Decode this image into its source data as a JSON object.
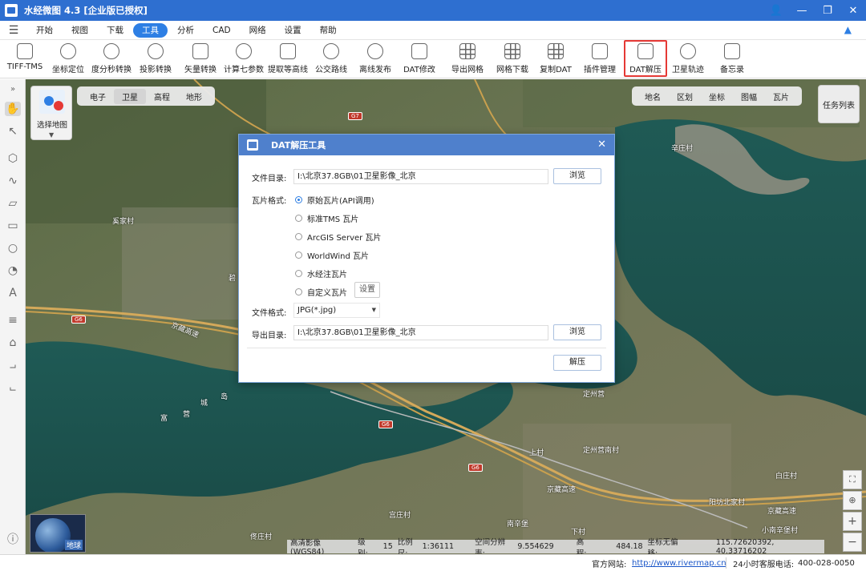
{
  "app": {
    "title": "水经微图 4.3 [企业版已授权]"
  },
  "menu": {
    "items": [
      "开始",
      "视图",
      "下载",
      "工具",
      "分析",
      "CAD",
      "网络",
      "设置",
      "帮助"
    ],
    "active": "工具"
  },
  "toolbar": {
    "items": [
      {
        "label": "TIFF-TMS",
        "icon": "tiff-tms-icon"
      },
      {
        "label": "坐标定位",
        "icon": "crosshair-icon"
      },
      {
        "label": "度分秒转换",
        "icon": "dms-convert-icon"
      },
      {
        "label": "投影转换",
        "icon": "projection-icon"
      },
      {
        "label": "矢量转换",
        "icon": "vector-convert-icon"
      },
      {
        "label": "计算七参数",
        "icon": "seven-param-icon"
      },
      {
        "label": "提取等高线",
        "icon": "contour-icon"
      },
      {
        "label": "公交路线",
        "icon": "bus-route-icon"
      },
      {
        "label": "离线发布",
        "icon": "offline-publish-icon"
      },
      {
        "label": "DAT修改",
        "icon": "dat-edit-icon"
      },
      {
        "label": "导出网格",
        "icon": "export-grid-icon"
      },
      {
        "label": "网格下载",
        "icon": "grid-download-icon"
      },
      {
        "label": "复制DAT",
        "icon": "copy-dat-icon"
      },
      {
        "label": "插件管理",
        "icon": "plugin-icon"
      },
      {
        "label": "DAT解压",
        "icon": "dat-extract-icon"
      },
      {
        "label": "卫星轨迹",
        "icon": "satellite-track-icon"
      },
      {
        "label": "备忘录",
        "icon": "memo-icon"
      }
    ],
    "highlighted": "DAT解压"
  },
  "maptypes": {
    "items": [
      "电子",
      "卫星",
      "高程",
      "地形"
    ],
    "selected": "卫星"
  },
  "overlays": {
    "items": [
      "地名",
      "区划",
      "坐标",
      "图幅",
      "瓦片"
    ]
  },
  "task_list": "任务列表",
  "select_map": "选择地图",
  "globe_label": "地球",
  "map_labels": [
    "G7",
    "G6",
    "G6",
    "G6",
    "京藏高速",
    "京藏高速",
    "京藏高速",
    "定州营",
    "上村",
    "定州营南村",
    "宫庄村",
    "白庄村",
    "阳坊北家村",
    "小南辛堡村",
    "辛庄村",
    "佟庄村",
    "富",
    "营",
    "城",
    "岛",
    "碧",
    "南辛堡",
    "奚家村",
    "下村"
  ],
  "dialog": {
    "title": "DAT解压工具",
    "file_dir_label": "文件目录:",
    "file_dir_value": "I:\\北京37.8GB\\01卫星影像_北京",
    "browse": "浏览",
    "tile_format_label": "瓦片格式:",
    "tile_options": [
      {
        "label": "原始瓦片(API调用)",
        "selected": true
      },
      {
        "label": "标准TMS 瓦片",
        "selected": false
      },
      {
        "label": "ArcGIS Server 瓦片",
        "selected": false
      },
      {
        "label": "WorldWind 瓦片",
        "selected": false
      },
      {
        "label": "水经注瓦片",
        "selected": false
      },
      {
        "label": "自定义瓦片",
        "selected": false
      }
    ],
    "settings": "设置",
    "file_format_label": "文件格式:",
    "file_format_value": "JPG(*.jpg)",
    "export_dir_label": "导出目录:",
    "export_dir_value": "I:\\北京37.8GB\\01卫星影像_北京",
    "browse2": "浏览",
    "extract": "解压"
  },
  "mapstatus": {
    "source": "高清影像(WGS84)",
    "level_label": "级别:",
    "level": "15",
    "scale_label": "比例尺:",
    "scale": "1:36111",
    "resolution_label": "空间分辨率:",
    "resolution": "9.554629",
    "elev_label": "高程:",
    "elev": "484.18",
    "coord_label": "坐标无偏移:",
    "coords": "115.72620392, 40.33716202"
  },
  "statusbar": {
    "site_label": "官方网站:",
    "site": "http://www.rivermap.cn",
    "hotline_label": "24小时客服电话:",
    "hotline": "400-028-0050"
  },
  "colors": {
    "titlebar": "#2e6fd0",
    "accent": "#2e7fe4",
    "highlight": "#e53935",
    "dialog_title": "#4f80cc"
  }
}
